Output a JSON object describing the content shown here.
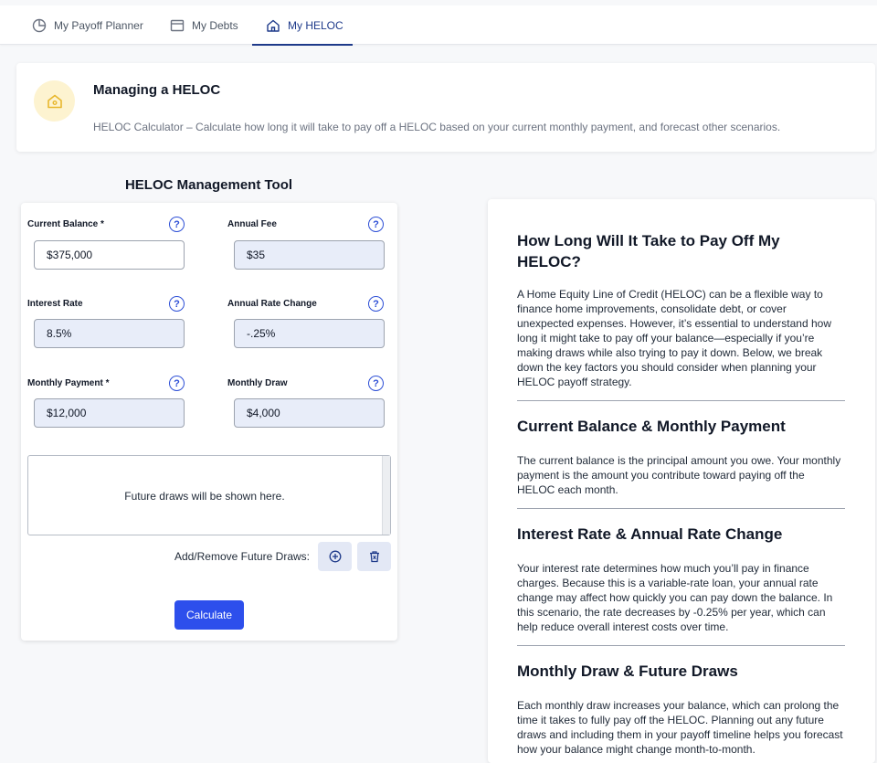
{
  "tabs": [
    {
      "label": "My Payoff Planner",
      "icon": "pie-chart-icon",
      "active": false
    },
    {
      "label": "My Debts",
      "icon": "card-icon",
      "active": false
    },
    {
      "label": "My HELOC",
      "icon": "house-icon",
      "active": true
    }
  ],
  "banner": {
    "title": "Managing a HELOC",
    "description": "HELOC Calculator – Calculate how long it will take to pay off a HELOC based on your current monthly payment, and forecast other scenarios.",
    "icon": "house-icon",
    "icon_color": "#e8b72d"
  },
  "tool": {
    "title": "HELOC Management Tool",
    "fields": {
      "current_balance": {
        "label": "Current Balance *",
        "value": "$375,000"
      },
      "annual_fee": {
        "label": "Annual Fee",
        "value": "$35"
      },
      "interest_rate": {
        "label": "Interest Rate",
        "value": "8.5%"
      },
      "annual_rate_change": {
        "label": "Annual Rate Change",
        "value": "-.25%"
      },
      "monthly_payment": {
        "label": "Monthly Payment *",
        "value": "$12,000"
      },
      "monthly_draw": {
        "label": "Monthly Draw",
        "value": "$4,000"
      }
    },
    "help_glyph": "?",
    "draws_placeholder": "Future draws will be shown here.",
    "add_remove_label": "Add/Remove Future Draws:",
    "calculate_label": "Calculate"
  },
  "article": {
    "sections": [
      {
        "heading": "How Long Will It Take to Pay Off My HELOC?",
        "body": "A Home Equity Line of Credit (HELOC) can be a flexible way to finance home improvements, consolidate debt, or cover unexpected expenses. However, it’s essential to understand how long it might take to pay off your balance—especially if you’re making draws while also trying to pay it down. Below, we break down the key factors you should consider when planning your HELOC payoff strategy."
      },
      {
        "heading": "Current Balance & Monthly Payment",
        "body": "The current balance is the principal amount you owe. Your monthly payment is the amount you contribute toward paying off the HELOC each month."
      },
      {
        "heading": "Interest Rate & Annual Rate Change",
        "body": "Your interest rate determines how much you’ll pay in finance charges. Because this is a variable-rate loan, your annual rate change may affect how quickly you can pay down the balance. In this scenario, the rate decreases by -0.25% per year, which can help reduce overall interest costs over time."
      },
      {
        "heading": "Monthly Draw & Future Draws",
        "body": "Each monthly draw increases your balance, which can prolong the time it takes to fully pay off the HELOC. Planning out any future draws and including them in your payoff timeline helps you forecast how your balance might change month-to-month."
      }
    ]
  },
  "colors": {
    "accent": "#2d4fec",
    "active_tab": "#1e3a8a",
    "field_fill": "#e8edf9"
  }
}
